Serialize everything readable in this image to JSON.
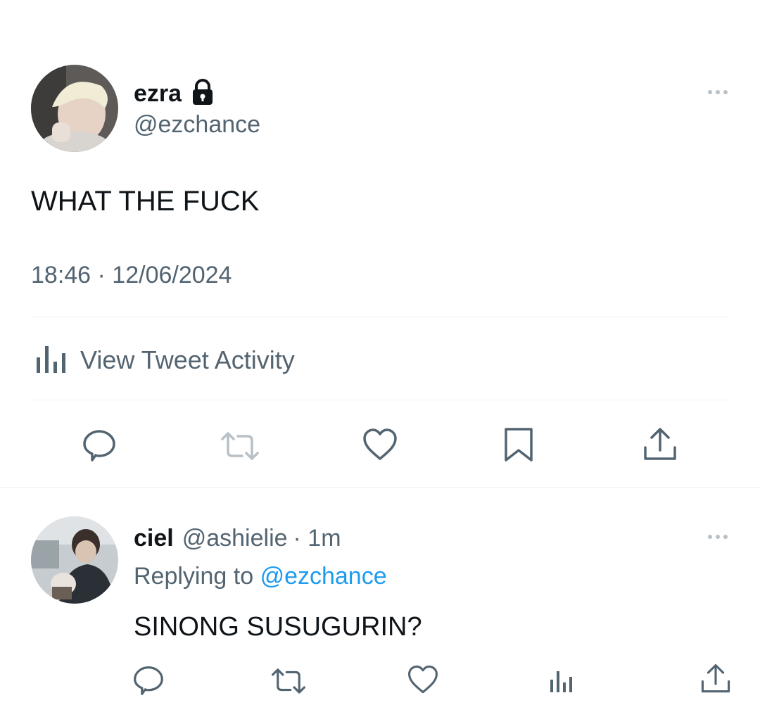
{
  "tweet": {
    "author_name": "ezra",
    "author_handle": "@ezchance",
    "text": "WHAT THE FUCK",
    "timestamp": "18:46 · 12/06/2024",
    "activity_label": "View Tweet Activity",
    "locked": true
  },
  "reply": {
    "author_name": "ciel",
    "author_handle": "@ashielie",
    "time": "· 1m",
    "replying_prefix": "Replying to",
    "replying_to": "@ezchance",
    "text": "SINONG SUSUGURIN?"
  },
  "icons": {
    "reply": "reply-icon",
    "retweet": "retweet-icon",
    "like": "heart-icon",
    "bookmark": "bookmark-icon",
    "share": "share-icon",
    "views": "analytics-icon",
    "more": "more-icon",
    "lock": "lock-icon"
  },
  "colors": {
    "text_primary": "#0f1419",
    "text_secondary": "#536471",
    "link": "#1d9bf0",
    "divider": "#eff3f4"
  }
}
